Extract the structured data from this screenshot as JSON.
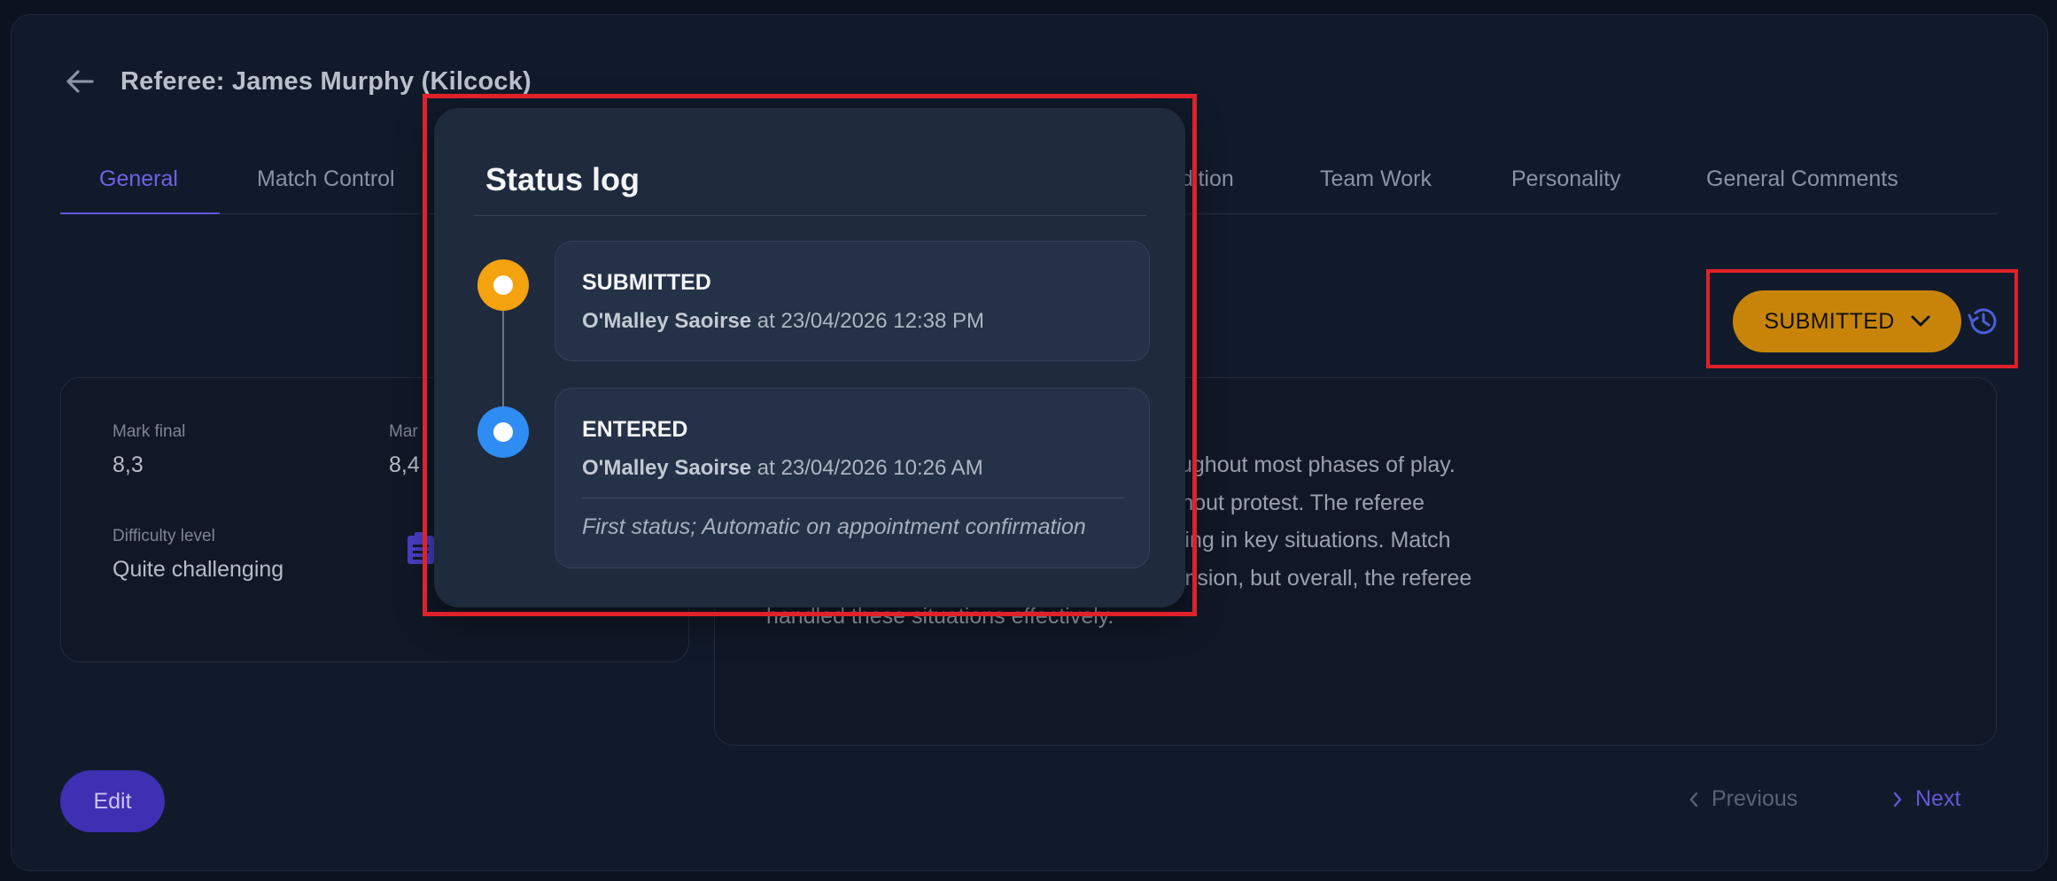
{
  "header": {
    "title": "Referee: James Murphy (Kilcock)"
  },
  "tabs": [
    {
      "label": "General"
    },
    {
      "label": "Match Control"
    },
    {
      "label": "dition"
    },
    {
      "label": "Team Work"
    },
    {
      "label": "Personality"
    },
    {
      "label": "General Comments"
    }
  ],
  "status_button": {
    "label": "SUBMITTED",
    "color": "#c88408"
  },
  "marks": {
    "final_label": "Mark final",
    "final_value": "8,3",
    "second_label": "Mar",
    "second_value": "8,4",
    "difficulty_label": "Difficulty level",
    "difficulty_value": "Quite challenging"
  },
  "comments": {
    "lines": [
      "nfidence and maintained good control throughout most phases of play.",
      "and decisions were generally accepted without protest. The referee",
      "reness, allowing for accurate decision-making in key situations. Match",
      "hysical duels and moments of increased tension, but overall, the referee",
      "handled these situations effectively."
    ]
  },
  "footer": {
    "edit_label": "Edit",
    "previous_label": "Previous",
    "next_label": "Next"
  },
  "status_log": {
    "title": "Status log",
    "entries": [
      {
        "status": "SUBMITTED",
        "user": "O'Malley Saoirse",
        "at_text": " at 23/04/2026 12:38 PM",
        "color": "#f4a20f"
      },
      {
        "status": "ENTERED",
        "user": "O'Malley Saoirse",
        "at_text": " at 23/04/2026 10:26 AM",
        "comment": "First status; Automatic on appointment confirmation",
        "color": "#2f8cf3"
      }
    ]
  }
}
